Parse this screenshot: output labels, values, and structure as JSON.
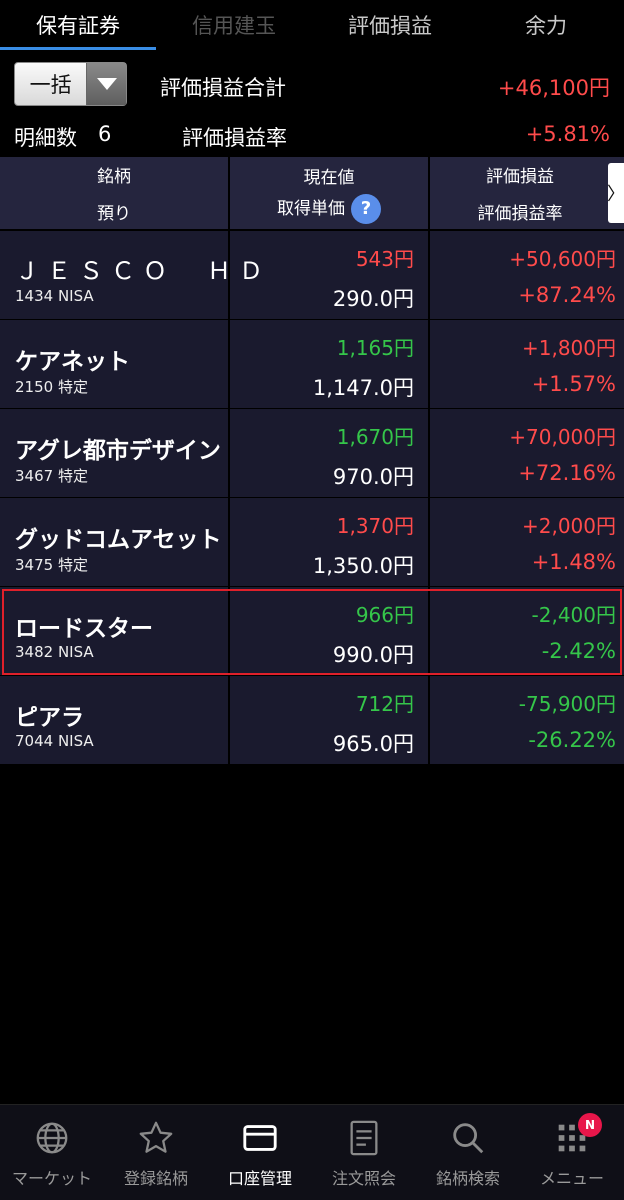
{
  "tabs": [
    {
      "label": "保有証券",
      "state": "active"
    },
    {
      "label": "信用建玉",
      "state": "disabled"
    },
    {
      "label": "評価損益",
      "state": "normal"
    },
    {
      "label": "余力",
      "state": "normal"
    }
  ],
  "summary": {
    "select_value": "一括",
    "total_label": "評価損益合計",
    "total_value": "+46,100円",
    "count_label": "明細数",
    "count_value": "6",
    "rate_label": "評価損益率",
    "rate_value": "+5.81%"
  },
  "header": {
    "col1_top": "銘柄",
    "col1_bottom": "預り",
    "col2_top": "現在値",
    "col2_bottom": "取得単価",
    "col3_top": "評価損益",
    "col3_bottom": "評価損益率",
    "help_icon": "?",
    "scroll_arrow": "〉"
  },
  "holdings": [
    {
      "name": "ＪＥＳＣＯ　ＨＤ",
      "code": "1434 NISA",
      "price": "543円",
      "cost": "290.0円",
      "pnl": "+50,600円",
      "rate": "+87.24%",
      "price_color": "red",
      "pnl_color": "red"
    },
    {
      "name": "ケアネット",
      "code": "2150 特定",
      "price": "1,165円",
      "cost": "1,147.0円",
      "pnl": "+1,800円",
      "rate": "+1.57%",
      "price_color": "green",
      "pnl_color": "red"
    },
    {
      "name": "アグレ都市デザイン",
      "code": "3467 特定",
      "price": "1,670円",
      "cost": "970.0円",
      "pnl": "+70,000円",
      "rate": "+72.16%",
      "price_color": "green",
      "pnl_color": "red"
    },
    {
      "name": "グッドコムアセット",
      "code": "3475 特定",
      "price": "1,370円",
      "cost": "1,350.0円",
      "pnl": "+2,000円",
      "rate": "+1.48%",
      "price_color": "red",
      "pnl_color": "red"
    },
    {
      "name": "ロードスター",
      "code": "3482 NISA",
      "price": "966円",
      "cost": "990.0円",
      "pnl": "-2,400円",
      "rate": "-2.42%",
      "price_color": "green",
      "pnl_color": "green",
      "highlighted": true
    },
    {
      "name": "ピアラ",
      "code": "7044 NISA",
      "price": "712円",
      "cost": "965.0円",
      "pnl": "-75,900円",
      "rate": "-26.22%",
      "price_color": "green",
      "pnl_color": "green"
    }
  ],
  "nav": [
    {
      "label": "マーケット",
      "icon": "globe-icon"
    },
    {
      "label": "登録銘柄",
      "icon": "star-icon"
    },
    {
      "label": "口座管理",
      "icon": "card-icon",
      "active": true
    },
    {
      "label": "注文照会",
      "icon": "document-icon"
    },
    {
      "label": "銘柄検索",
      "icon": "search-icon"
    },
    {
      "label": "メニュー",
      "icon": "grid-menu-icon",
      "badge": "N"
    }
  ],
  "colors": {
    "positive": "#ff4b4b",
    "negative": "#35c64a",
    "accent": "#3a8ee6",
    "row_bg": "#1a1a2e",
    "header_bg": "#25253e"
  }
}
